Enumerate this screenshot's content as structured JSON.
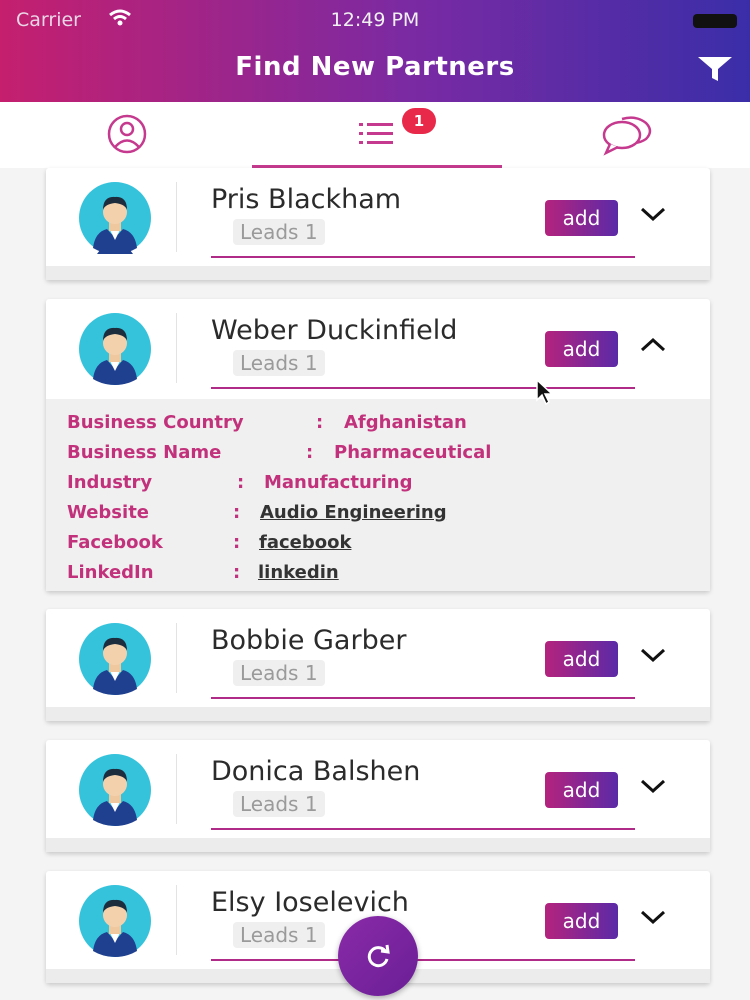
{
  "status_bar": {
    "carrier": "Carrier",
    "time": "12:49 PM"
  },
  "header": {
    "title": "Find New Partners"
  },
  "tabs": {
    "list_badge": "1"
  },
  "partners": [
    {
      "name": "Pris Blackham",
      "leads": "Leads 1",
      "add_label": "add"
    },
    {
      "name": "Weber Duckinfield",
      "leads": "Leads 1",
      "add_label": "add",
      "details": [
        {
          "label": "Business Country",
          "value": "Afghanistan",
          "is_link": false
        },
        {
          "label": "Business Name",
          "value": "Pharmaceutical",
          "is_link": false
        },
        {
          "label": "Industry",
          "value": "Manufacturing",
          "is_link": false
        },
        {
          "label": "Website",
          "value": "Audio Engineering",
          "is_link": true
        },
        {
          "label": "Facebook",
          "value": "facebook",
          "is_link": true
        },
        {
          "label": "LinkedIn",
          "value": "linkedin",
          "is_link": true
        }
      ]
    },
    {
      "name": "Bobbie Garber",
      "leads": "Leads 1",
      "add_label": "add"
    },
    {
      "name": "Donica Balshen",
      "leads": "Leads 1",
      "add_label": "add"
    },
    {
      "name": "Elsy Ioselevich",
      "leads": "Leads 1",
      "add_label": "add"
    }
  ],
  "colors": {
    "accent": "#c2327c",
    "gradient_start": "#c51f6e",
    "gradient_end": "#3a2ea8",
    "badge": "#e8294a"
  },
  "icons": [
    "wifi-icon",
    "battery-icon",
    "filter-icon",
    "profile-icon",
    "list-icon",
    "chat-icon",
    "chevron-down-icon",
    "chevron-up-icon",
    "refresh-icon"
  ]
}
